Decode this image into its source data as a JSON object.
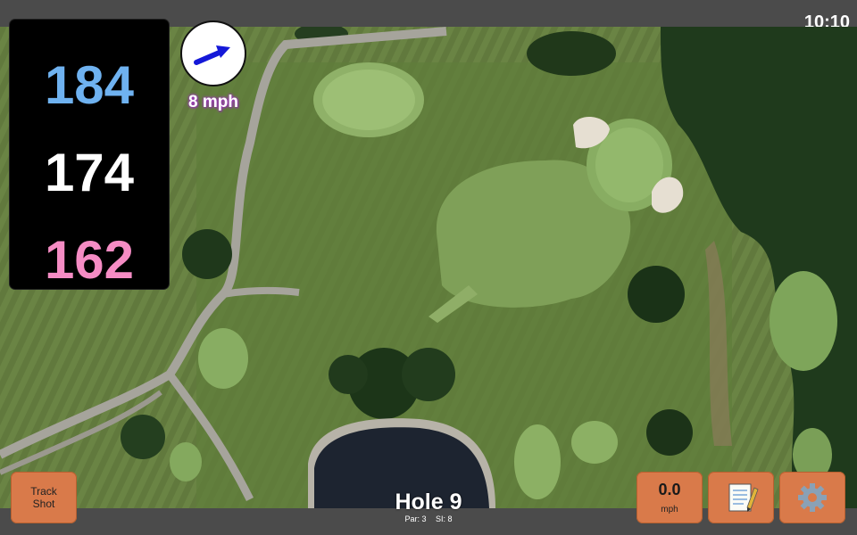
{
  "status": {
    "time": "10:10"
  },
  "distances": {
    "back": "184",
    "middle": "174",
    "front": "162"
  },
  "wind": {
    "speed_label": "8 mph",
    "icon": "wind-direction-arrow-icon"
  },
  "buttons": {
    "track_line1": "Track",
    "track_line2": "Shot",
    "speed_value": "0.0",
    "speed_unit": "mph",
    "notes_icon": "notepad-icon",
    "settings_icon": "gear-icon"
  },
  "hole": {
    "title": "Hole 9",
    "par": "Par: 3",
    "si": "SI: 8"
  },
  "colors": {
    "back": "#6fb2f0",
    "middle": "#ffffff",
    "front": "#f58cc4",
    "button": "#d97a4a"
  }
}
